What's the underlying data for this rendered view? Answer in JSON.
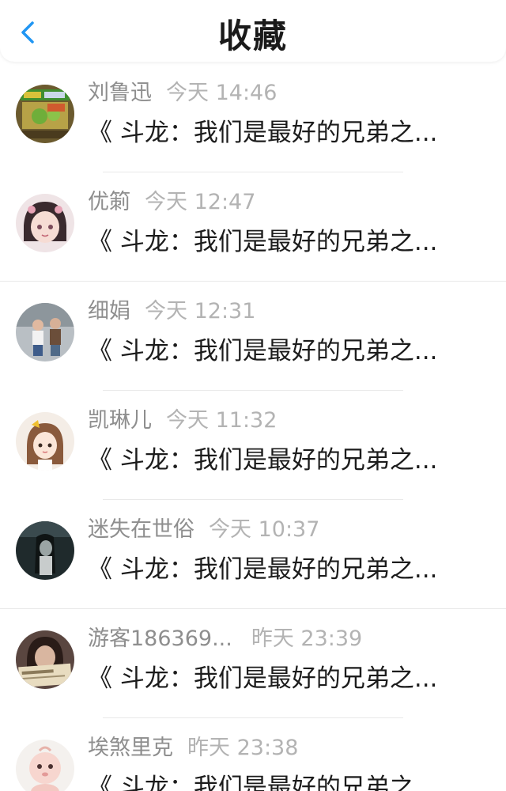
{
  "header": {
    "title": "收藏",
    "back_icon": "chevron-left-icon",
    "accent_color": "#2196f3"
  },
  "items": [
    {
      "name": "刘鲁迅",
      "time": "今天 14:46",
      "title": "《 斗龙：我们是最好的兄弟之...",
      "avatar": "game-poster-avatar"
    },
    {
      "name": "优箣",
      "time": "今天 12:47",
      "title": "《 斗龙：我们是最好的兄弟之...",
      "avatar": "anime-girl-avatar"
    },
    {
      "name": "细娟",
      "time": "今天 12:31",
      "title": "《 斗龙：我们是最好的兄弟之...",
      "avatar": "people-photo-avatar"
    },
    {
      "name": "凯琳儿",
      "time": "今天 11:32",
      "title": "《 斗龙：我们是最好的兄弟之...",
      "avatar": "cartoon-girl-avatar"
    },
    {
      "name": "迷失在世俗",
      "time": "今天 10:37",
      "title": "《 斗龙：我们是最好的兄弟之...",
      "avatar": "dark-portrait-avatar"
    },
    {
      "name": "游客186369...",
      "time": "昨天 23:39",
      "title": "《 斗龙：我们是最好的兄弟之...",
      "avatar": "newspaper-portrait-avatar"
    },
    {
      "name": "埃煞里克",
      "time": "昨天 23:38",
      "title": "《 斗龙：我们是最好的兄弟之...",
      "avatar": "toy-doll-avatar"
    }
  ]
}
